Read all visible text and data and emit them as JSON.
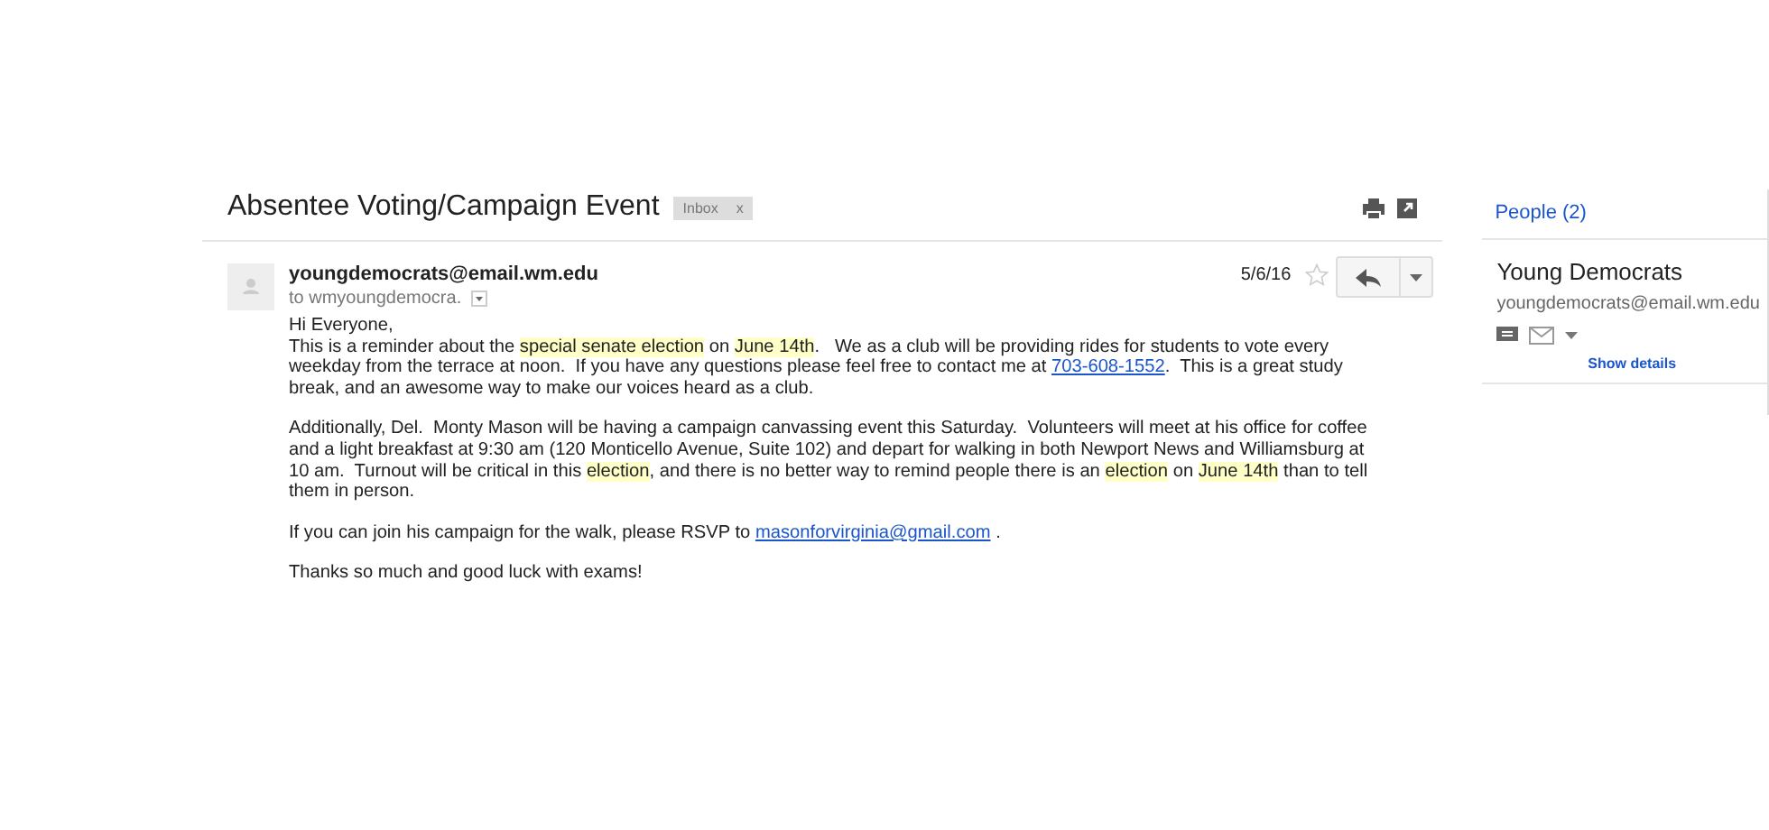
{
  "subject": "Absentee Voting/Campaign Event",
  "label": {
    "text": "Inbox",
    "close": "x"
  },
  "message": {
    "sender": "youngdemocrats@email.wm.edu",
    "recipient": "to wmyoungdemocra.",
    "date": "5/6/16",
    "starred": false,
    "paragraphs": [
      [
        {
          "kind": "text",
          "text": "Hi Everyone,"
        }
      ],
      [
        {
          "kind": "text",
          "text": "This is a reminder about the "
        },
        {
          "kind": "highlight",
          "text": "special senate election"
        },
        {
          "kind": "text",
          "text": " on "
        },
        {
          "kind": "highlight",
          "text": "June 14th"
        },
        {
          "kind": "text",
          "text": ".   We as a club will be providing rides for students to vote every weekday from the terrace at noon.  If you have any questions please feel free to contact me at "
        },
        {
          "kind": "link",
          "text": "703-608-1552"
        },
        {
          "kind": "text",
          "text": ".  This is a great study break, and an awesome way to make our voices heard as a club."
        }
      ],
      [
        {
          "kind": "text",
          "text": "Additionally, Del.  Monty Mason will be having a campaign canvassing event this Saturday.  Volunteers will meet at his office for coffee and a light breakfast at 9:30 am (120 Monticello Avenue, Suite 102) and depart for walking in both Newport News and Williamsburg at 10 am.  Turnout will be critical in this "
        },
        {
          "kind": "highlight",
          "text": "election"
        },
        {
          "kind": "text",
          "text": ", and there is no better way to remind people there is an "
        },
        {
          "kind": "highlight",
          "text": "election"
        },
        {
          "kind": "text",
          "text": " on "
        },
        {
          "kind": "highlight",
          "text": "June 14th"
        },
        {
          "kind": "text",
          "text": " than to tell them in person."
        }
      ],
      [
        {
          "kind": "text",
          "text": "If you can join his campaign for the walk, please RSVP to "
        },
        {
          "kind": "link",
          "text": "masonforvirginia@gmail.com"
        },
        {
          "kind": "text",
          "text": " ."
        }
      ],
      [
        {
          "kind": "text",
          "text": "Thanks so much and good luck with exams!"
        }
      ]
    ]
  },
  "people": {
    "heading": "People (2)",
    "name": "Young Democrats",
    "email": "youngdemocrats@email.wm.edu",
    "action": "Show details"
  }
}
